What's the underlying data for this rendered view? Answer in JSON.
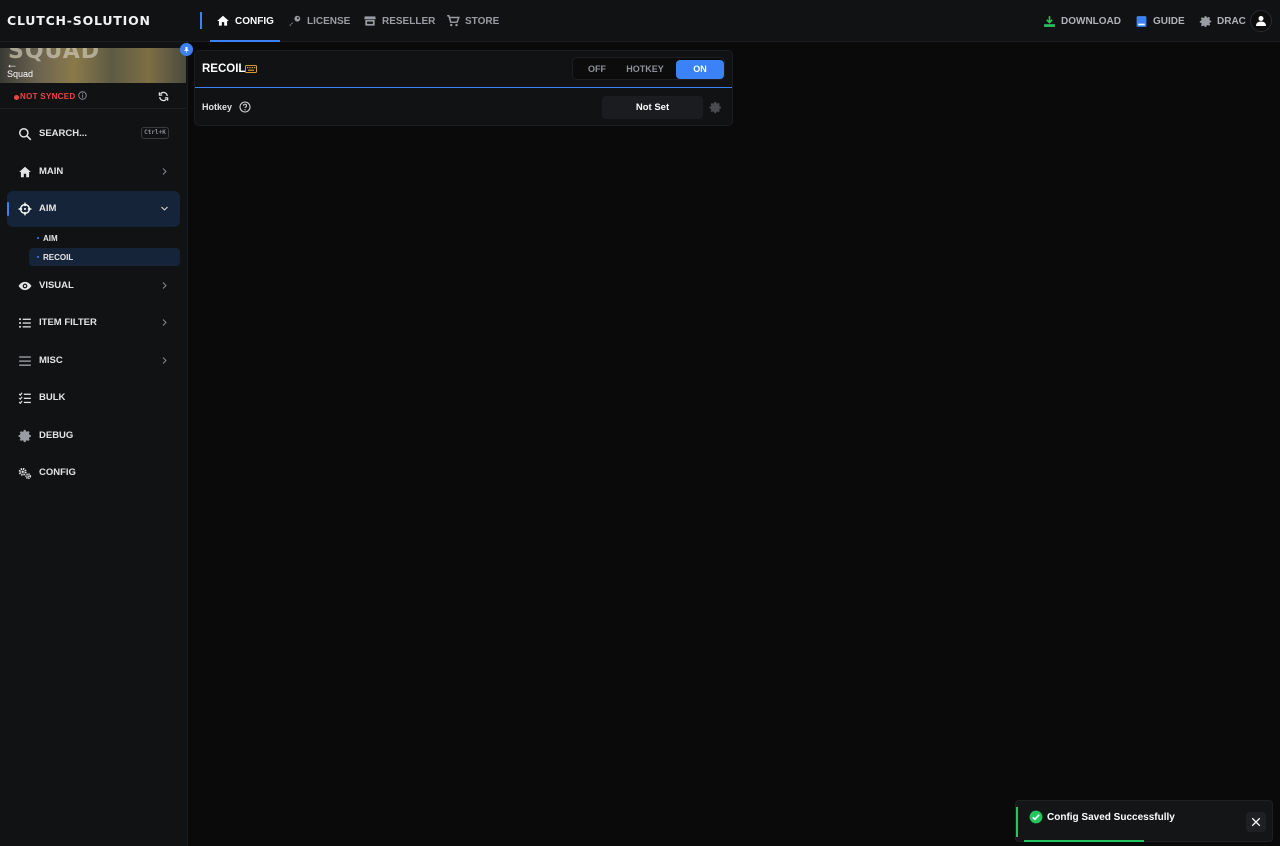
{
  "app": {
    "brand": "CLUTCH-SOLUTION"
  },
  "topnav": {
    "tabs": [
      {
        "label": "CONFIG",
        "icon": "home-icon",
        "active": true
      },
      {
        "label": "LICENSE",
        "icon": "key-icon",
        "active": false
      },
      {
        "label": "RESELLER",
        "icon": "store-icon",
        "active": false
      },
      {
        "label": "STORE",
        "icon": "cart-icon",
        "active": false
      }
    ],
    "right": {
      "download": "DOWNLOAD",
      "guide": "GUIDE",
      "user": "DRAC"
    }
  },
  "sidebar": {
    "game": {
      "banner_text": "SQUAD",
      "name": "Squad",
      "back_icon": "arrow-left-icon"
    },
    "sync_status": "NOT SYNCED",
    "search": {
      "label": "SEARCH...",
      "shortcut": "Ctrl+K"
    },
    "items": [
      {
        "label": "MAIN",
        "icon": "home-icon"
      },
      {
        "label": "AIM",
        "icon": "crosshair-icon",
        "expanded": true
      },
      {
        "label": "VISUAL",
        "icon": "eye-icon"
      },
      {
        "label": "ITEM FILTER",
        "icon": "list-icon"
      },
      {
        "label": "MISC",
        "icon": "menu-icon"
      },
      {
        "label": "BULK",
        "icon": "checklist-icon"
      },
      {
        "label": "DEBUG",
        "icon": "gear-icon"
      },
      {
        "label": "CONFIG",
        "icon": "gears-icon"
      }
    ],
    "aim_sub": [
      {
        "label": "AIM",
        "active": false
      },
      {
        "label": "RECOIL",
        "active": true
      }
    ]
  },
  "panel": {
    "title": "RECOIL",
    "mode": {
      "options": [
        "OFF",
        "HOTKEY",
        "ON"
      ],
      "selected": "ON"
    },
    "hotkey": {
      "label": "Hotkey",
      "value": "Not Set"
    }
  },
  "toast": {
    "message": "Config Saved Successfully",
    "progress": 0.48
  },
  "colors": {
    "accent": "#3b82f6",
    "success": "#22c55e",
    "danger": "#ef4444",
    "warning": "#d49a2a"
  }
}
